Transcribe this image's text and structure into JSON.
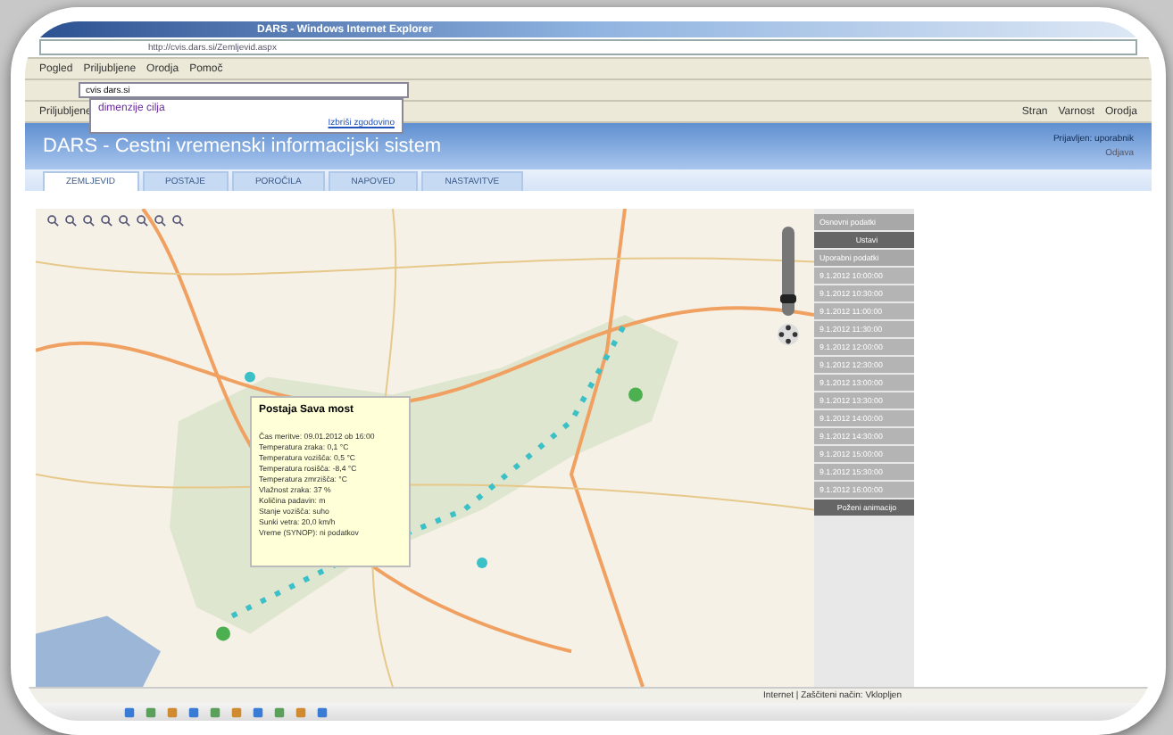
{
  "browser": {
    "title": "DARS - Windows Internet Explorer",
    "address": "http://cvis.dars.si/Zemljevid.aspx",
    "menu": [
      "Pogled",
      "Priljubljene",
      "Orodja",
      "Pomoč"
    ],
    "search": {
      "value": "cvis dars.si"
    },
    "suggestions": [
      {
        "text": "dimenzije cilja"
      }
    ],
    "clear_history": "Izbriši zgodovino",
    "favorites": "Priljubljene",
    "tools": [
      "Stran",
      "Varnost",
      "Orodja"
    ]
  },
  "page": {
    "title": "DARS - Cestni vremenski informacijski sistem",
    "user": "Prijavljen: uporabnik",
    "logout": "Odjava",
    "tabs": [
      {
        "label": "ZEMLJEVID",
        "selected": true
      },
      {
        "label": "POSTAJE",
        "selected": false
      },
      {
        "label": "POROČILA",
        "selected": false
      },
      {
        "label": "NAPOVED",
        "selected": false
      },
      {
        "label": "NASTAVITVE",
        "selected": false
      }
    ],
    "zoom_slider": {
      "level": 0.15
    },
    "popup": {
      "title": "Postaja Sava most",
      "lines": [
        "Čas meritve: 09.01.2012 ob 16:00",
        "Temperatura zraka: 0,1 °C",
        "Temperatura vozišča: 0,5 °C",
        "Temperatura rosišča: -8,4 °C",
        "Temperatura zmrzišča: °C",
        "Vlažnost zraka: 37 %",
        "Količina padavin: m",
        "Stanje vozišča: suho",
        "Sunki vetra: 20,0 km/h",
        "Vreme (SYNOP): ni podatkov"
      ]
    },
    "panel": [
      {
        "kind": "header",
        "text": "Osnovni podatki"
      },
      {
        "kind": "action",
        "text": "Ustavi"
      },
      {
        "kind": "header",
        "text": "Uporabni podatki"
      },
      {
        "kind": "time",
        "text": "9.1.2012 10:00:00"
      },
      {
        "kind": "time",
        "text": "9.1.2012 10:30:00"
      },
      {
        "kind": "time",
        "text": "9.1.2012 11:00:00"
      },
      {
        "kind": "time",
        "text": "9.1.2012 11:30:00"
      },
      {
        "kind": "time",
        "text": "9.1.2012 12:00:00"
      },
      {
        "kind": "time",
        "text": "9.1.2012 12:30:00"
      },
      {
        "kind": "time",
        "text": "9.1.2012 13:00:00"
      },
      {
        "kind": "time",
        "text": "9.1.2012 13:30:00"
      },
      {
        "kind": "time",
        "text": "9.1.2012 14:00:00"
      },
      {
        "kind": "time",
        "text": "9.1.2012 14:30:00"
      },
      {
        "kind": "time",
        "text": "9.1.2012 15:00:00"
      },
      {
        "kind": "time",
        "text": "9.1.2012 15:30:00"
      },
      {
        "kind": "time",
        "text": "9.1.2012 16:00:00"
      },
      {
        "kind": "action",
        "text": "Poženi animacijo"
      }
    ]
  },
  "status_bar": {
    "zone": "Internet | Zaščiteni način: Vklopljen"
  }
}
